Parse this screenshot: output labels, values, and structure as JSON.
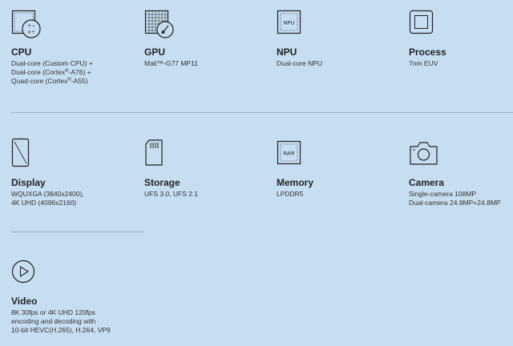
{
  "specs": {
    "cpu": {
      "icon": "cpu-icon",
      "title": "CPU",
      "lines": [
        "Dual-core (Custom CPU) +",
        "Dual-core (Cortex",
        "-A76) +",
        "Quad-core (Cortex",
        "-A55)"
      ],
      "reg": "®"
    },
    "gpu": {
      "icon": "gpu-icon",
      "title": "GPU",
      "lines": [
        "Mali™-G77 MP11"
      ]
    },
    "npu": {
      "icon": "npu-icon",
      "icon_label": "NPU",
      "title": "NPU",
      "lines": [
        "Dual-core NPU"
      ]
    },
    "process": {
      "icon": "process-icon",
      "title": "Process",
      "lines": [
        "7nm EUV"
      ]
    },
    "display": {
      "icon": "display-icon",
      "title": "Display",
      "lines": [
        "WQUXGA (3840x2400),",
        "4K UHD (4096x2160)"
      ]
    },
    "storage": {
      "icon": "storage-icon",
      "title": "Storage",
      "lines": [
        "UFS 3.0, UFS 2.1"
      ]
    },
    "memory": {
      "icon": "ram-icon",
      "icon_label": "RAM",
      "title": "Memory",
      "lines": [
        "LPDDR5"
      ]
    },
    "camera": {
      "icon": "camera-icon",
      "title": "Camera",
      "lines": [
        "Single-camera 108MP",
        "Dual-camera 24.8MP+24.8MP"
      ]
    },
    "video": {
      "icon": "play-icon",
      "title": "Video",
      "lines": [
        "8K 30fps or 4K UHD 120fps",
        "encoding and decoding with",
        "10-bit HEVC(H.265), H.264, VP9"
      ]
    }
  }
}
